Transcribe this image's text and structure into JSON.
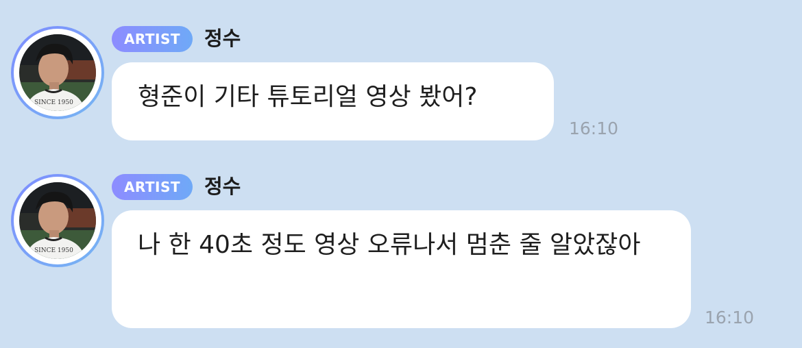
{
  "messages": [
    {
      "badge": "ARTIST",
      "sender": "정수",
      "text": "형준이 기타 튜토리얼 영상 봤어?",
      "time": "16:10"
    },
    {
      "badge": "ARTIST",
      "sender": "정수",
      "text": "나 한 40초 정도 영상 오류나서 멈춘 줄 알았잖아",
      "time": "16:10"
    }
  ],
  "avatar": {
    "shirt_print": [
      "SINCE 1950"
    ]
  },
  "colors": {
    "background": "#cddff2",
    "bubble": "#ffffff",
    "badge_start": "#8d8cff",
    "badge_end": "#6fa9f7",
    "timestamp": "#9aa3ae"
  }
}
